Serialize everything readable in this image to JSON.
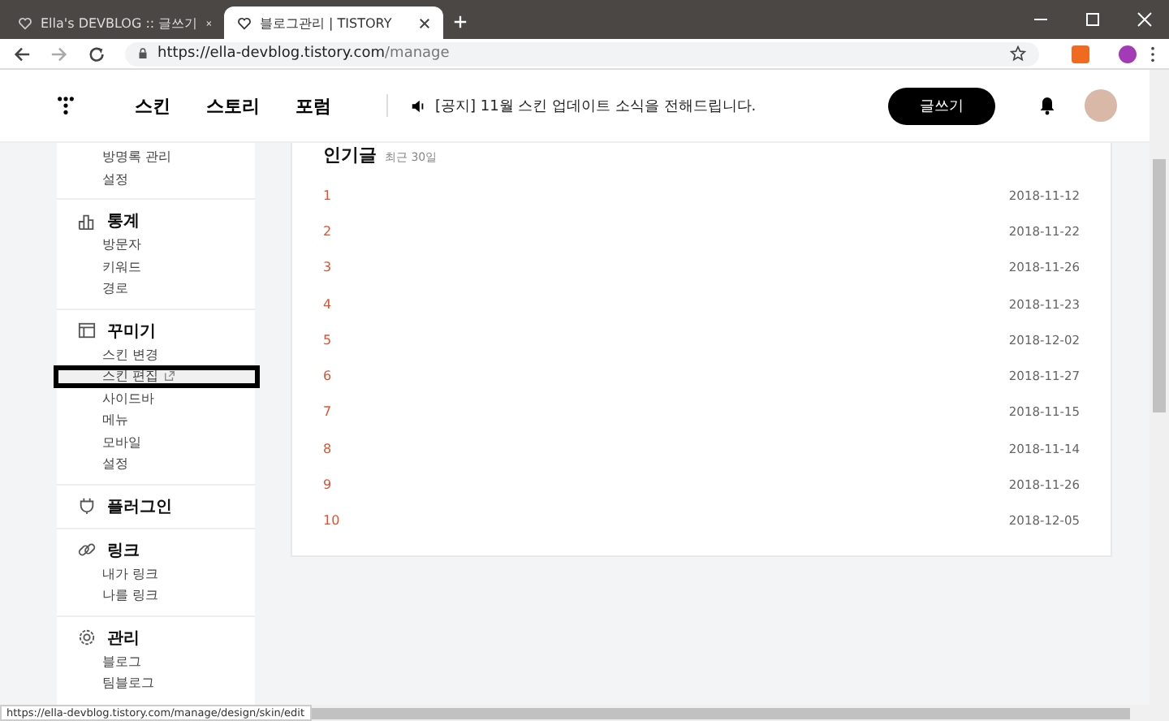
{
  "browser": {
    "tabs": [
      {
        "title": "Ella's DEVBLOG :: 글쓰기",
        "selected": false
      },
      {
        "title": "블로그관리 | TISTORY",
        "selected": true
      }
    ],
    "address": {
      "host": "https://ella-devblog.tistory.com",
      "path": "/manage"
    }
  },
  "header": {
    "nav": [
      "스킨",
      "스토리",
      "포럼"
    ],
    "notice": "[공지] 11월 스킨 업데이트 소식을 전해드립니다.",
    "write_button": "글쓰기"
  },
  "sidebar": {
    "sections": [
      {
        "items": [
          {
            "label": "방명록 관리",
            "kind": "plain",
            "outlined": false
          },
          {
            "label": "설정",
            "kind": "plain",
            "outlined": false
          }
        ]
      },
      {
        "heading": "통계",
        "items": [
          {
            "label": "방문자",
            "kind": "plain",
            "outlined": false
          },
          {
            "label": "키워드",
            "kind": "plain",
            "outlined": false
          },
          {
            "label": "경로",
            "kind": "plain",
            "outlined": false
          }
        ]
      },
      {
        "heading": "꾸미기",
        "items": [
          {
            "label": "스킨 변경",
            "kind": "plain",
            "outlined": false
          },
          {
            "label": "스킨 편집",
            "kind": "external",
            "outlined": true
          },
          {
            "label": "사이드바",
            "kind": "plain",
            "outlined": false
          },
          {
            "label": "메뉴",
            "kind": "plain",
            "outlined": false
          },
          {
            "label": "모바일",
            "kind": "plain",
            "outlined": false
          },
          {
            "label": "설정",
            "kind": "plain",
            "outlined": false
          }
        ]
      },
      {
        "heading": "플러그인"
      },
      {
        "heading": "링크",
        "items": [
          {
            "label": "내가 링크",
            "kind": "plain",
            "outlined": false
          },
          {
            "label": "나를 링크",
            "kind": "plain",
            "outlined": false
          }
        ]
      },
      {
        "heading": "관리",
        "items": [
          {
            "label": "블로그",
            "kind": "plain",
            "outlined": false
          },
          {
            "label": "팀블로그",
            "kind": "plain",
            "outlined": false
          }
        ]
      }
    ]
  },
  "popular": {
    "title": "인기글",
    "subtitle": "최근 30일",
    "rows": [
      {
        "rank": "1",
        "date": "2018-11-12"
      },
      {
        "rank": "2",
        "date": "2018-11-22"
      },
      {
        "rank": "3",
        "date": "2018-11-26"
      },
      {
        "rank": "4",
        "date": "2018-11-23"
      },
      {
        "rank": "5",
        "date": "2018-12-02"
      },
      {
        "rank": "6",
        "date": "2018-11-27"
      },
      {
        "rank": "7",
        "date": "2018-11-15"
      },
      {
        "rank": "8",
        "date": "2018-11-14"
      },
      {
        "rank": "9",
        "date": "2018-11-26"
      },
      {
        "rank": "10",
        "date": "2018-12-05"
      }
    ]
  },
  "status_bar": {
    "url": "https://ella-devblog.tistory.com/manage/design/skin/edit"
  }
}
